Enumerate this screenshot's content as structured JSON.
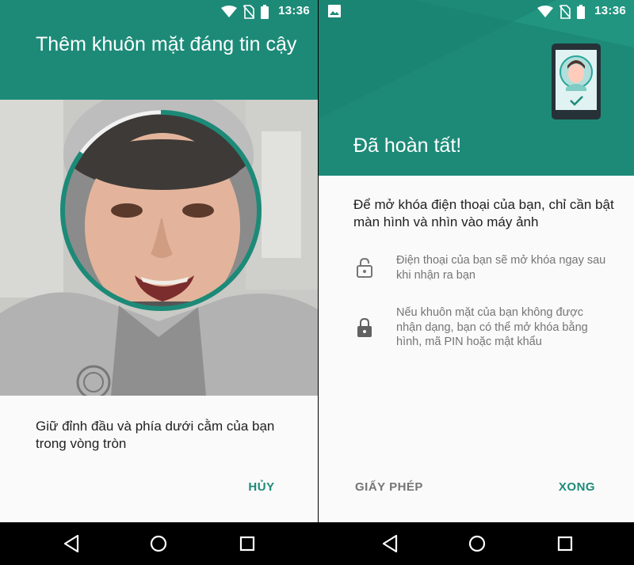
{
  "status_bar": {
    "time": "13:36",
    "icons": [
      "wifi-icon",
      "no-sim-icon",
      "battery-icon"
    ],
    "right_extra_icon": "image-notification-icon"
  },
  "left_screen": {
    "title": "Thêm khuôn mặt đáng tin cậy",
    "instruction": "Giữ đỉnh đầu và phía dưới cằm của bạn trong vòng tròn",
    "cancel_label": "HỦY",
    "scan_progress": 0.85
  },
  "right_screen": {
    "title": "Đã hoàn tất!",
    "description": "Để mở khóa điện thoại của bạn, chỉ cần bật màn hình và nhìn vào máy ảnh",
    "info_items": [
      {
        "icon": "lock-outline-icon",
        "text": "Điện thoại của bạn sẽ mở khóa ngay sau khi nhận ra bạn"
      },
      {
        "icon": "lock-filled-icon",
        "text": "Nếu khuôn mặt của bạn không được nhận dạng, bạn có thể mở khóa bằng hình, mã PIN hoặc mật khẩu"
      }
    ],
    "license_label": "GIẤY PHÉP",
    "done_label": "XONG"
  },
  "nav_bar": {
    "left": [
      "back-icon",
      "home-icon",
      "recents-icon"
    ],
    "right": [
      "back-icon",
      "home-icon",
      "recents-icon"
    ]
  },
  "colors": {
    "accent": "#1d8a78",
    "text_primary": "#212121",
    "text_secondary": "#757575",
    "background": "#fafafa"
  }
}
